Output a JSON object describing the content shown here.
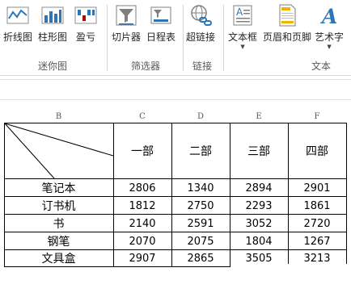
{
  "ribbon": {
    "groups": [
      {
        "label": "迷你图",
        "buttons": [
          {
            "label": "折线图",
            "icon": "sparkline-line-icon"
          },
          {
            "label": "柱形图",
            "icon": "sparkline-column-icon"
          },
          {
            "label": "盈亏",
            "icon": "sparkline-winloss-icon"
          }
        ]
      },
      {
        "label": "筛选器",
        "buttons": [
          {
            "label": "切片器",
            "icon": "slicer-icon"
          },
          {
            "label": "日程表",
            "icon": "timeline-icon"
          }
        ]
      },
      {
        "label": "链接",
        "buttons": [
          {
            "label": "超链接",
            "icon": "hyperlink-icon"
          }
        ]
      },
      {
        "label": "文本",
        "buttons": [
          {
            "label": "文本框",
            "icon": "textbox-icon"
          },
          {
            "label": "页眉和页脚",
            "icon": "header-footer-icon"
          },
          {
            "label": "艺术字",
            "icon": "wordart-icon"
          }
        ]
      }
    ]
  },
  "sheet": {
    "columns": [
      "B",
      "C",
      "D",
      "E",
      "F"
    ],
    "header_row": [
      "一部",
      "二部",
      "三部",
      "四部"
    ],
    "rows": [
      {
        "item": "笔记本",
        "values": [
          "2806",
          "1340",
          "2894",
          "2901"
        ]
      },
      {
        "item": "订书机",
        "values": [
          "1812",
          "2750",
          "2293",
          "1861"
        ]
      },
      {
        "item": "书",
        "values": [
          "2140",
          "2591",
          "3052",
          "2720"
        ]
      },
      {
        "item": "钢笔",
        "values": [
          "2070",
          "2075",
          "1804",
          "1267"
        ]
      },
      {
        "item": "文具盒",
        "values": [
          "2907",
          "2865",
          "3505",
          "3213"
        ]
      }
    ]
  },
  "colors": {
    "icon_blue": "#2e75b6",
    "icon_gray": "#7f7f7f",
    "icon_red": "#c00000",
    "grid_border": "#000000"
  }
}
